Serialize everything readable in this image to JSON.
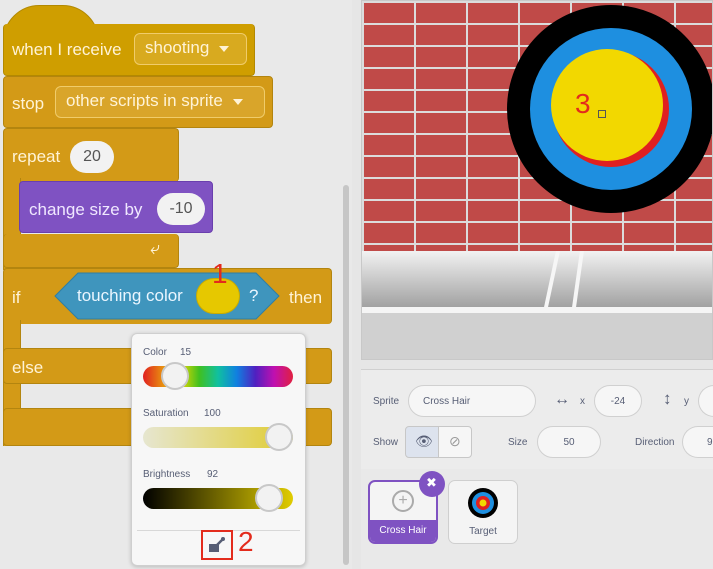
{
  "blocks": {
    "hat_label": "when I receive",
    "hat_message": "shooting",
    "stop_label": "stop",
    "stop_option": "other scripts in sprite",
    "repeat_label": "repeat",
    "repeat_count": "20",
    "change_size_label": "change size by",
    "change_size_value": "-10",
    "if_label": "if",
    "touching_label": "touching color",
    "touching_q": "?",
    "then_label": "then",
    "else_label": "else"
  },
  "annotations": {
    "one": "1",
    "two": "2",
    "three": "3"
  },
  "color_picker": {
    "color_label": "Color",
    "color_value": "15",
    "saturation_label": "Saturation",
    "saturation_value": "100",
    "brightness_label": "Brightness",
    "brightness_value": "92",
    "color_level": 0.15,
    "saturation_level": 1.0,
    "brightness_level": 0.92,
    "eyedropper_icon": "eyedropper-icon"
  },
  "sprite_info": {
    "sprite_label": "Sprite",
    "sprite_name": "Cross Hair",
    "x_label": "x",
    "x_value": "-24",
    "y_label": "y",
    "show_label": "Show",
    "size_label": "Size",
    "size_value": "50",
    "direction_label": "Direction",
    "direction_value": "9"
  },
  "sprites": [
    {
      "name": "Cross Hair",
      "selected": true
    },
    {
      "name": "Target",
      "selected": false
    }
  ],
  "colors": {
    "touching_swatch": "#e6c800",
    "selected_sprite": "#7f52c2",
    "target_outer": "#000000",
    "target_blue": "#1e8fe0",
    "target_yellow": "#f2d800"
  }
}
